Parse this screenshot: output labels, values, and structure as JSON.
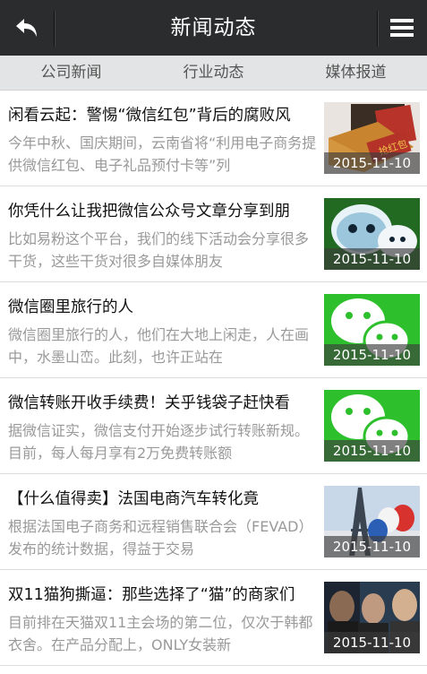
{
  "header": {
    "title": "新闻动态",
    "back_icon": "back-arrow-icon",
    "menu_icon": "hamburger-menu-icon"
  },
  "tabs": [
    {
      "label": "公司新闻"
    },
    {
      "label": "行业动态"
    },
    {
      "label": "媒体报道"
    }
  ],
  "news": [
    {
      "title": "闲看云起：警惕“微信红包”背后的腐败风",
      "summary": "今年中秋、国庆期间，云南省将“利用电子商务提供微信红包、电子礼品预付卡等”列",
      "date": "2015-11-10",
      "thumb": "red-envelope-photo"
    },
    {
      "title": "你凭什么让我把微信公众号文章分享到朋",
      "summary": "比如易粉这个平台，我们的线下活动会分享很多干货，这些干货对很多自媒体朋友",
      "date": "2015-11-10",
      "thumb": "wechat-mascot-image"
    },
    {
      "title": "微信圈里旅行的人",
      "summary": "微信圈里旅行的人，他们在大地上闲走，人在画中，水墨山峦。此刻，也许正站在",
      "date": "2015-11-10",
      "thumb": "wechat-logo-image"
    },
    {
      "title": "微信转账开收手续费！关乎钱袋子赶快看",
      "summary": "据微信证实，微信支付开始逐步试行转账新规。目前，每人每月享有2万免费转账额",
      "date": "2015-11-10",
      "thumb": "wechat-logo-image"
    },
    {
      "title": "【什么值得卖】法国电商汽车转化竟",
      "summary": "根据法国电子商务和远程销售联合会（FEVAD）发布的统计数据，得益于交易",
      "date": "2015-11-10",
      "thumb": "eiffel-tower-balloons-photo"
    },
    {
      "title": "双11猫狗撕逼：那些选择了“猫”的商家们",
      "summary": "目前排在天猫双11主会场的第二位，仅次于韩都衣舍。在产品分配上，ONLY女装新",
      "date": "2015-11-10",
      "thumb": "men-portrait-photo"
    }
  ],
  "colors": {
    "header_bg": "#2a2c2d",
    "tab_bg": "#e3e4e5",
    "wechat_green": "#2ec02c"
  }
}
